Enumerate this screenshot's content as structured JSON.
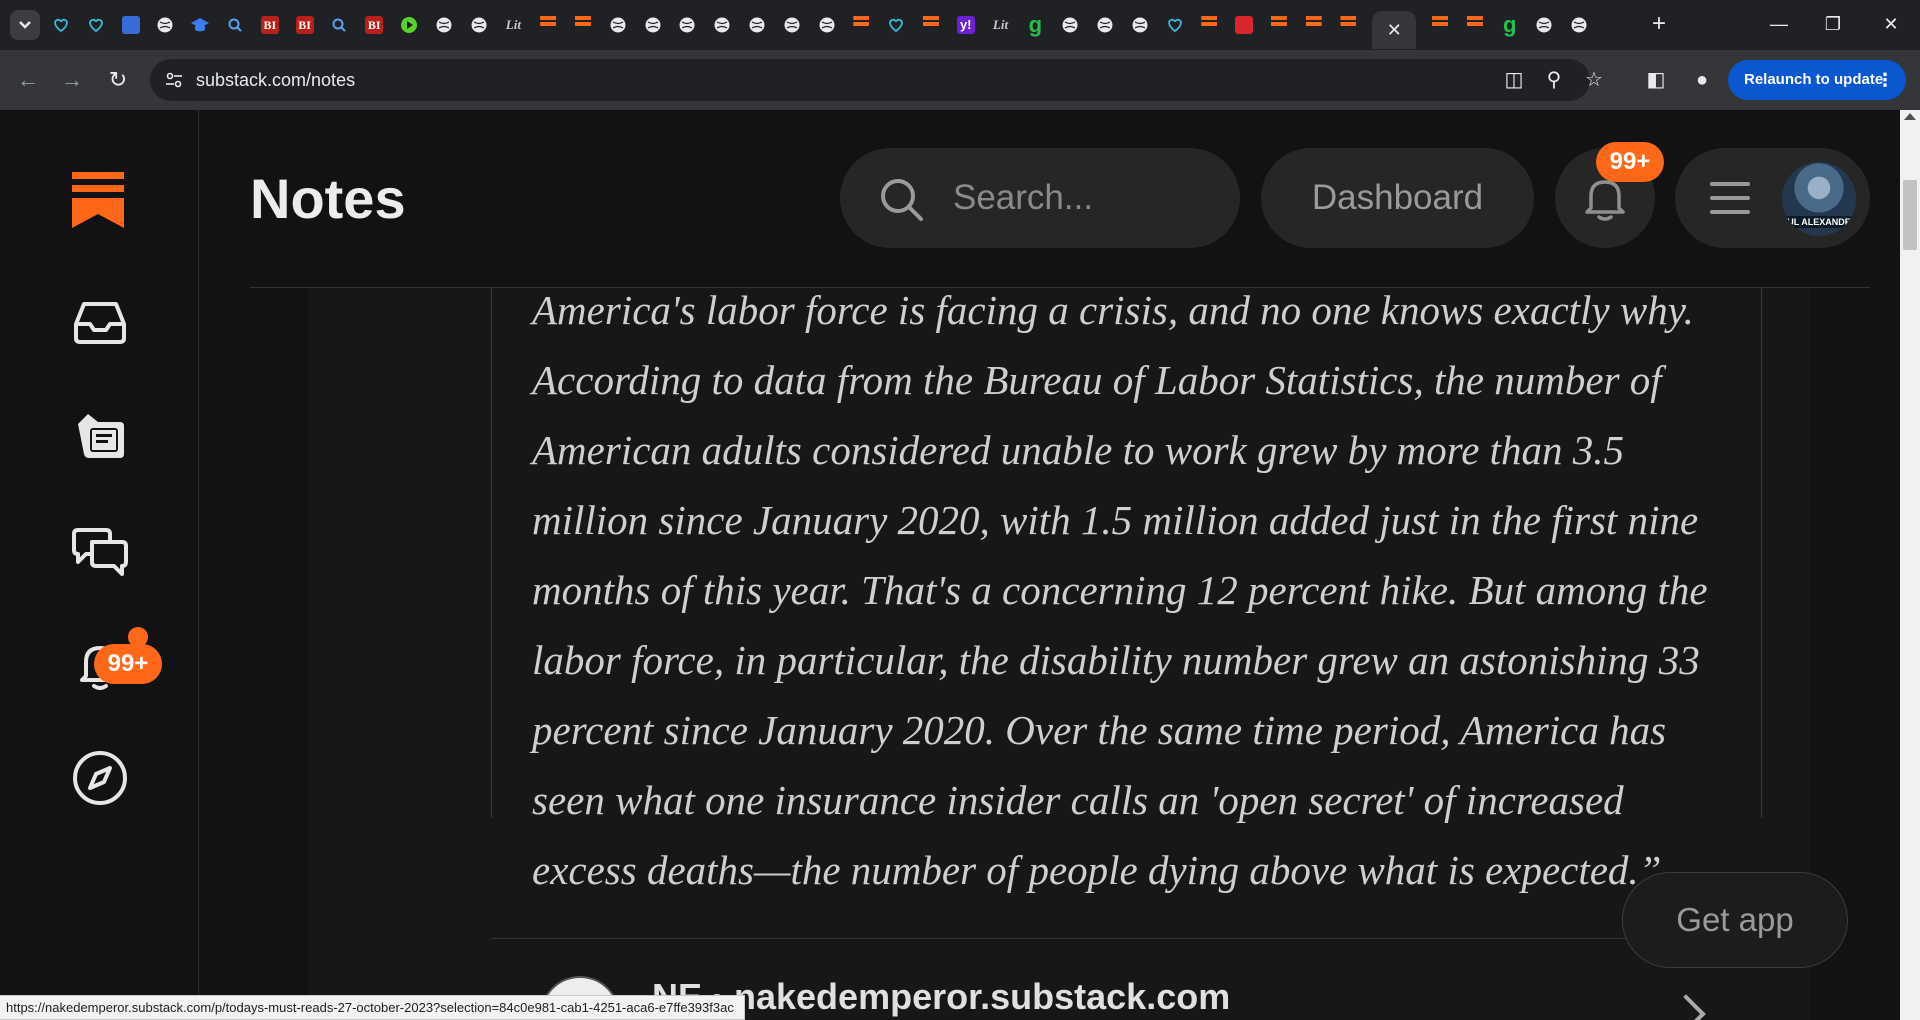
{
  "browser": {
    "tab_count_visible": 44,
    "tab_close_glyph": "✕",
    "new_tab_glyph": "+",
    "url": "substack.com/notes",
    "relaunch_label": "Relaunch to update",
    "status_url": "https://nakedemperor.substack.com/p/todays-must-reads-27-october-2023?selection=84c0e981-cab1-4251-aca6-e7ffe393f3ac"
  },
  "sidebar": {
    "items": [
      {
        "name": "inbox",
        "icon": "inbox-icon"
      },
      {
        "name": "reader",
        "icon": "reader-icon"
      },
      {
        "name": "chat",
        "icon": "chat-icon",
        "has_dot": true
      },
      {
        "name": "activity",
        "icon": "bell-icon",
        "badge": "99+"
      },
      {
        "name": "explore",
        "icon": "compass-icon"
      }
    ]
  },
  "header": {
    "title": "Notes",
    "search_placeholder": "Search...",
    "dashboard_label": "Dashboard",
    "notifications_badge": "99+",
    "avatar_caption": "UL ALEXANDE"
  },
  "post": {
    "quote": "America's labor force is facing a crisis, and no one knows exactly why. According to data from the Bureau of Labor Statistics, the number of American adults considered unable to work grew by more than 3.5 million since January 2020, with 1.5 million added just in the first nine months of this year. That's a concerning 12 percent hike. But among the labor force, in particular, the disability number grew an astonishing 33 percent since January 2020. Over the same time period, America has seen what one insurance insider calls an 'open secret' of increased excess deaths—the number of people dying above what is expected.”",
    "next_author": "NE · nakedemperor.substack.com"
  },
  "get_app_label": "Get app",
  "colors": {
    "accent": "#ff6719",
    "relaunch": "#0b57d0",
    "page_bg": "#121212"
  }
}
